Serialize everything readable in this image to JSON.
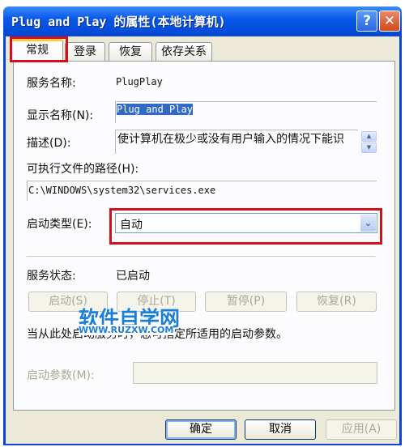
{
  "window": {
    "title": "Plug and Play 的属性(本地计算机)",
    "help_label": "?",
    "close_label": "✕"
  },
  "tabs": [
    {
      "label": "常规",
      "selected": true
    },
    {
      "label": "登录"
    },
    {
      "label": "恢复"
    },
    {
      "label": "依存关系"
    }
  ],
  "general": {
    "service_name_label": "服务名称:",
    "service_name": "PlugPlay",
    "display_name_label": "显示名称(N):",
    "display_name": "Plug and Play",
    "description_label": "描述(D):",
    "description": "使计算机在极少或没有用户输入的情况下能识",
    "path_label": "可执行文件的路径(H):",
    "path": "C:\\WINDOWS\\system32\\services.exe",
    "startup_type_label": "启动类型(E):",
    "startup_type": "自动",
    "status_label": "服务状态:",
    "status": "已启动",
    "buttons": {
      "start": "启动(S)",
      "stop": "停止(T)",
      "pause": "暂停(P)",
      "resume": "恢复(R)"
    },
    "hint": "当从此处启动服务时，您可指定所适用的启动参数。",
    "params_label": "启动参数(M):",
    "params_value": ""
  },
  "watermark": {
    "main": "软件自学网",
    "sub": "WWW.RUZXW.COM"
  },
  "footer": {
    "ok": "确定",
    "cancel": "取消",
    "apply": "应用(A)"
  },
  "colors": {
    "highlight_box": "#d0101a",
    "titlebar": "#0858e8",
    "selection": "#316ac5"
  }
}
